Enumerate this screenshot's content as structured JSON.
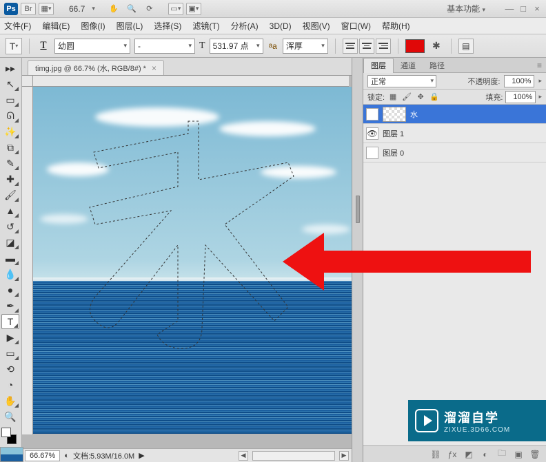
{
  "titlebar": {
    "zoom": "66.7",
    "workspace": "基本功能"
  },
  "menus": [
    {
      "label": "文件(F)"
    },
    {
      "label": "编辑(E)"
    },
    {
      "label": "图像(I)"
    },
    {
      "label": "图层(L)"
    },
    {
      "label": "选择(S)"
    },
    {
      "label": "滤镜(T)"
    },
    {
      "label": "分析(A)"
    },
    {
      "label": "3D(D)"
    },
    {
      "label": "视图(V)"
    },
    {
      "label": "窗口(W)"
    },
    {
      "label": "帮助(H)"
    }
  ],
  "options": {
    "font": "幼圆",
    "font_style": "-",
    "font_size": "531.97 点",
    "aa_label": "aa",
    "aa_mode": "浑厚",
    "fill_color": "#e00808"
  },
  "document": {
    "tab_label": "timg.jpg @ 66.7% (水, RGB/8#) *"
  },
  "status": {
    "zoom": "66.67%",
    "doc_label": "文档:5.93M/16.0M"
  },
  "panel": {
    "tabs": [
      {
        "label": "图层",
        "active": true
      },
      {
        "label": "通道",
        "active": false
      },
      {
        "label": "路径",
        "active": false
      }
    ],
    "blend_mode": "正常",
    "opacity_label": "不透明度:",
    "opacity_value": "100%",
    "lock_label": "锁定:",
    "fill_label": "填充:",
    "fill_value": "100%",
    "layers": [
      {
        "name": "水",
        "visible": true,
        "selected": true,
        "thumb": "trans"
      },
      {
        "name": "图层 1",
        "visible": true,
        "selected": false,
        "thumb": "ocean"
      },
      {
        "name": "图层 0",
        "visible": false,
        "selected": false,
        "thumb": "ocean"
      }
    ]
  },
  "watermark": {
    "line1": "溜溜自学",
    "line2": "ZIXUE.3D66.COM"
  },
  "icons": {
    "ps": "Ps",
    "br": "Br",
    "t_tool": "T",
    "t_underline_label": "T"
  }
}
